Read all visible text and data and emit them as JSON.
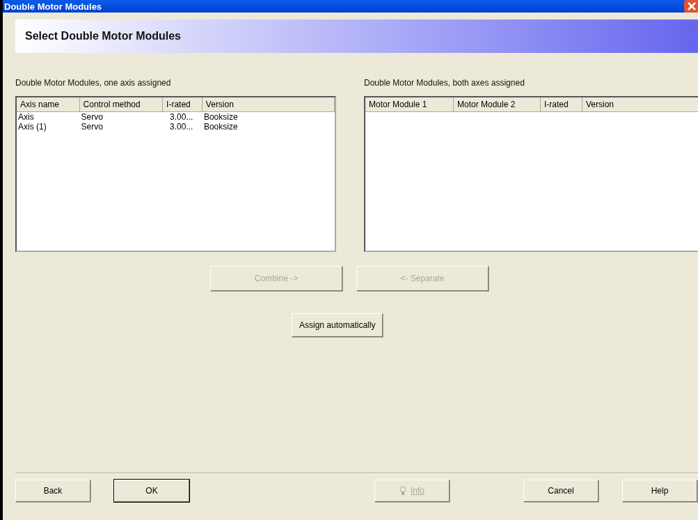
{
  "window": {
    "title": "Double Motor Modules"
  },
  "header": {
    "title": "Select Double Motor Modules"
  },
  "left_list": {
    "label": "Double Motor Modules, one axis assigned",
    "columns": [
      "Axis name",
      "Control method",
      "I-rated",
      "Version"
    ],
    "rows": [
      [
        "Axis",
        "Servo",
        "3.00...",
        "Booksize"
      ],
      [
        "Axis (1)",
        "Servo",
        "3.00...",
        "Booksize"
      ]
    ]
  },
  "right_list": {
    "label": "Double Motor Modules, both axes assigned",
    "columns": [
      "Motor Module 1",
      "Motor Module 2",
      "I-rated",
      "Version"
    ]
  },
  "move_buttons": [
    {
      "label": "Combine ->",
      "disabled": true
    },
    {
      "label": "<- Separate",
      "disabled": true
    }
  ],
  "assign_button": {
    "label": "Assign automatically",
    "disabled": false
  },
  "footer_buttons": [
    {
      "kind": "text",
      "label": "Back",
      "disabled": false,
      "default": false
    },
    {
      "kind": "text",
      "label": "OK",
      "disabled": false,
      "default": true
    },
    {
      "kind": "info",
      "label": "Info",
      "disabled": true,
      "default": false
    },
    {
      "kind": "text",
      "label": "Cancel",
      "disabled": false,
      "default": false
    },
    {
      "kind": "text",
      "label": "Help",
      "disabled": false,
      "default": false
    }
  ]
}
